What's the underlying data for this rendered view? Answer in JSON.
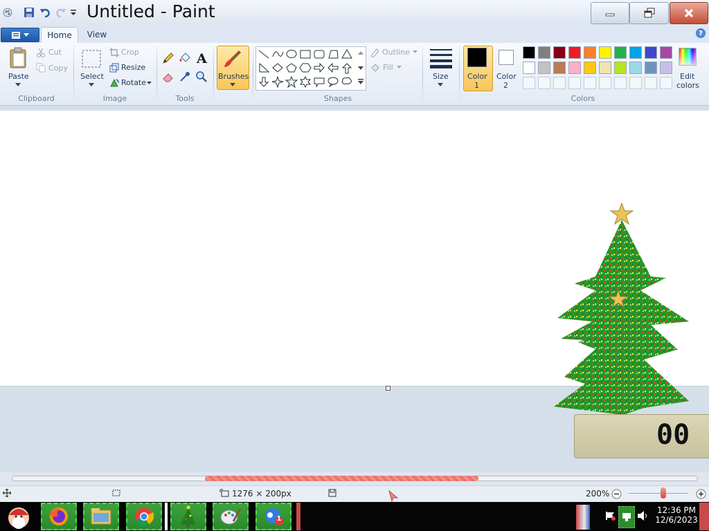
{
  "window": {
    "title": "Untitled - Paint",
    "quick_access": [
      "paint-app-icon",
      "save-icon",
      "undo-icon",
      "redo-icon",
      "customize-dropdown-icon"
    ],
    "controls": [
      "minimize",
      "restore",
      "close"
    ]
  },
  "tabs": [
    {
      "label": "Home",
      "active": true
    },
    {
      "label": "View",
      "active": false
    }
  ],
  "ribbon": {
    "clipboard": {
      "group_label": "Clipboard",
      "paste": "Paste",
      "cut": "Cut",
      "copy": "Copy"
    },
    "image": {
      "group_label": "Image",
      "select": "Select",
      "crop": "Crop",
      "resize": "Resize",
      "rotate": "Rotate"
    },
    "tools": {
      "group_label": "Tools",
      "items": [
        "pencil-icon",
        "fill-icon",
        "text-icon",
        "eraser-icon",
        "color-picker-icon",
        "magnifier-icon"
      ]
    },
    "brushes": {
      "label": "Brushes"
    },
    "shapes": {
      "group_label": "Shapes",
      "outline": "Outline",
      "fill": "Fill",
      "items": [
        "line",
        "curve",
        "oval",
        "rectangle",
        "rounded-rectangle",
        "polygon",
        "triangle",
        "right-triangle",
        "diamond",
        "pentagon",
        "hexagon",
        "right-arrow",
        "left-arrow",
        "up-arrow",
        "down-arrow",
        "four-point-star",
        "five-point-star",
        "six-point-star",
        "rounded-callout",
        "oval-callout",
        "cloud-callout"
      ]
    },
    "size": {
      "label": "Size"
    },
    "colors": {
      "group_label": "Colors",
      "color1_line1": "Color",
      "color1_line2": "1",
      "color2_line1": "Color",
      "color2_line2": "2",
      "edit_line1": "Edit",
      "edit_line2": "colors",
      "color1": "#000000",
      "color2": "#ffffff",
      "palette_row1": [
        "#000000",
        "#7f7f7f",
        "#880015",
        "#ed1c24",
        "#ff7f27",
        "#fff200",
        "#22b14c",
        "#00a2e8",
        "#3f48cc",
        "#a349a4"
      ],
      "palette_row2": [
        "#ffffff",
        "#c3c3c3",
        "#b97a57",
        "#ffaec9",
        "#ffc90e",
        "#efe4b0",
        "#b5e61d",
        "#99d9ea",
        "#7092be",
        "#c8bfe7"
      ],
      "palette_row3_count": 10
    }
  },
  "statusbar": {
    "dimensions": "1276 × 200px",
    "zoom": "200%",
    "zoom_level": 0.58
  },
  "taskbar": {
    "apps": [
      "santa-start-icon",
      "firefox-icon",
      "file-explorer-icon",
      "chrome-icon",
      "christmas-tree-icon",
      "paint-icon",
      "messenger-icon"
    ],
    "notification_badge": "1",
    "time": "12:36 PM",
    "date": "12/6/2023"
  },
  "desktop_widget": {
    "clock_digits": "00"
  }
}
